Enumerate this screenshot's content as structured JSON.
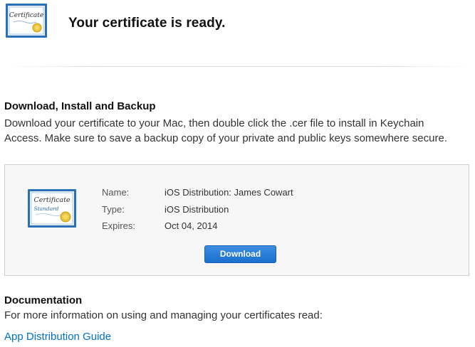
{
  "header": {
    "title": "Your certificate is ready.",
    "icon": "certificate-icon"
  },
  "download_section": {
    "title": "Download, Install and Backup",
    "text": "Download your certificate to your Mac, then double click the .cer file to install in Keychain Access. Make sure to save a backup copy of your private and public keys somewhere secure."
  },
  "certificate": {
    "icon": "certificate-standard-icon",
    "icon_text_top": "Certificate",
    "icon_text_bottom": "Standard",
    "name_label": "Name:",
    "name_value": "iOS Distribution: James Cowart",
    "type_label": "Type:",
    "type_value": "iOS Distribution",
    "expires_label": "Expires:",
    "expires_value": "Oct 04, 2014",
    "download_label": "Download"
  },
  "documentation": {
    "title": "Documentation",
    "text": "For more information on using and managing your certificates read:",
    "link_label": "App Distribution Guide"
  },
  "colors": {
    "accent": "#1a6fd0",
    "link": "#0070c9",
    "box_background": "#f7f7f7"
  }
}
